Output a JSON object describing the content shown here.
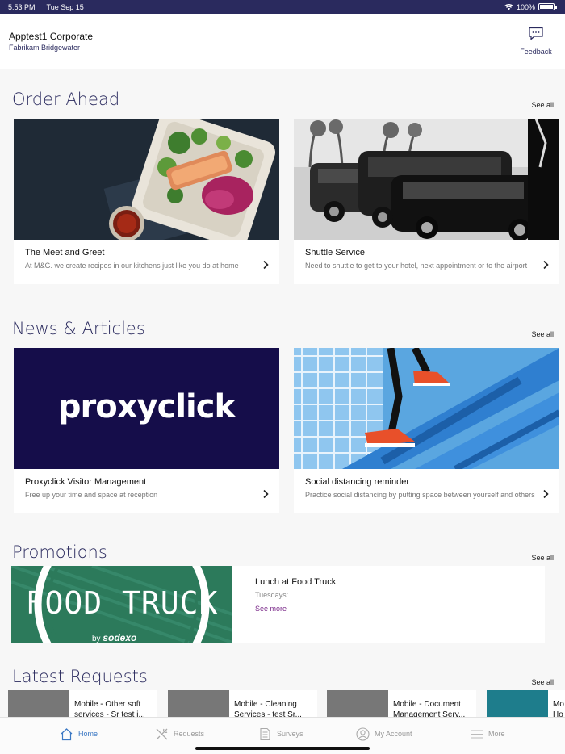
{
  "status_bar": {
    "time": "5:53 PM",
    "date": "Tue Sep 15",
    "battery": "100%"
  },
  "header": {
    "title": "Apptest1 Corporate",
    "subtitle": "Fabrikam Bridgewater",
    "feedback_label": "Feedback"
  },
  "order_ahead": {
    "title": "Order Ahead",
    "see_all": "See all",
    "cards": [
      {
        "title": "The Meet and Greet",
        "description": "At M&G. we create recipes in our kitchens just like you do at home"
      },
      {
        "title": "Shuttle Service",
        "description": "Need to shuttle to get to your hotel, next appointment or to the airport"
      }
    ]
  },
  "news": {
    "title": "News & Articles",
    "see_all": "See all",
    "cards": [
      {
        "title": "Proxyclick Visitor Management",
        "description": "Free up your time and space at reception",
        "logo_text": "proxyclick"
      },
      {
        "title": "Social distancing reminder",
        "description": "Practice social distancing by putting space between yourself and others"
      }
    ]
  },
  "promotions": {
    "title": "Promotions",
    "see_all": "See all",
    "item": {
      "title": "Lunch at Food Truck",
      "subtitle": "Tuesdays:",
      "see_more": "See more",
      "banner_text": "FOOD TRUCK",
      "banner_by": "by",
      "banner_brand": "sodexo"
    }
  },
  "latest_requests": {
    "title": "Latest Requests",
    "see_all": "See all",
    "items": [
      {
        "title": "Mobile - Other soft services - Sr test i..."
      },
      {
        "title": "Mobile - Cleaning Services - test Sr..."
      },
      {
        "title": "Mobile - Document Management Serv..."
      },
      {
        "title": "Mo Ho"
      }
    ]
  },
  "tab_bar": {
    "tabs": [
      {
        "label": "Home",
        "icon": "home-icon"
      },
      {
        "label": "Requests",
        "icon": "tools-icon"
      },
      {
        "label": "Surveys",
        "icon": "document-icon"
      },
      {
        "label": "My Account",
        "icon": "account-icon"
      },
      {
        "label": "More",
        "icon": "menu-icon"
      }
    ],
    "active_color": "#3b78c4"
  },
  "colors": {
    "brand": "#2a2a5e",
    "link": "#7b2a8a"
  }
}
